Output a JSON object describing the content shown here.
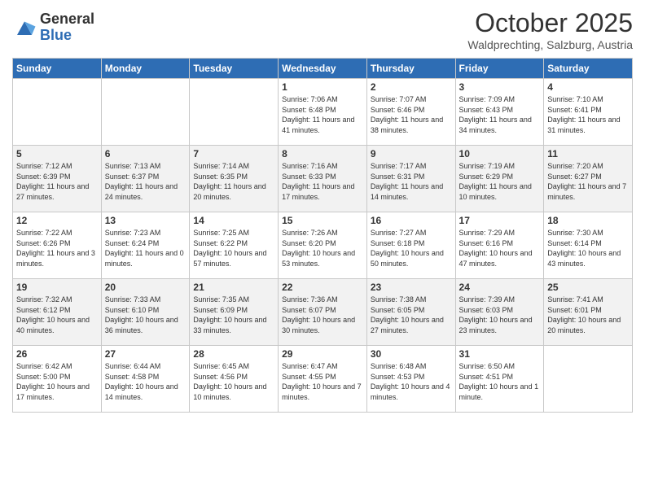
{
  "logo": {
    "general": "General",
    "blue": "Blue"
  },
  "header": {
    "month": "October 2025",
    "location": "Waldprechting, Salzburg, Austria"
  },
  "weekdays": [
    "Sunday",
    "Monday",
    "Tuesday",
    "Wednesday",
    "Thursday",
    "Friday",
    "Saturday"
  ],
  "weeks": [
    [
      {
        "day": "",
        "info": ""
      },
      {
        "day": "",
        "info": ""
      },
      {
        "day": "",
        "info": ""
      },
      {
        "day": "1",
        "info": "Sunrise: 7:06 AM\nSunset: 6:48 PM\nDaylight: 11 hours\nand 41 minutes."
      },
      {
        "day": "2",
        "info": "Sunrise: 7:07 AM\nSunset: 6:46 PM\nDaylight: 11 hours\nand 38 minutes."
      },
      {
        "day": "3",
        "info": "Sunrise: 7:09 AM\nSunset: 6:43 PM\nDaylight: 11 hours\nand 34 minutes."
      },
      {
        "day": "4",
        "info": "Sunrise: 7:10 AM\nSunset: 6:41 PM\nDaylight: 11 hours\nand 31 minutes."
      }
    ],
    [
      {
        "day": "5",
        "info": "Sunrise: 7:12 AM\nSunset: 6:39 PM\nDaylight: 11 hours\nand 27 minutes."
      },
      {
        "day": "6",
        "info": "Sunrise: 7:13 AM\nSunset: 6:37 PM\nDaylight: 11 hours\nand 24 minutes."
      },
      {
        "day": "7",
        "info": "Sunrise: 7:14 AM\nSunset: 6:35 PM\nDaylight: 11 hours\nand 20 minutes."
      },
      {
        "day": "8",
        "info": "Sunrise: 7:16 AM\nSunset: 6:33 PM\nDaylight: 11 hours\nand 17 minutes."
      },
      {
        "day": "9",
        "info": "Sunrise: 7:17 AM\nSunset: 6:31 PM\nDaylight: 11 hours\nand 14 minutes."
      },
      {
        "day": "10",
        "info": "Sunrise: 7:19 AM\nSunset: 6:29 PM\nDaylight: 11 hours\nand 10 minutes."
      },
      {
        "day": "11",
        "info": "Sunrise: 7:20 AM\nSunset: 6:27 PM\nDaylight: 11 hours\nand 7 minutes."
      }
    ],
    [
      {
        "day": "12",
        "info": "Sunrise: 7:22 AM\nSunset: 6:26 PM\nDaylight: 11 hours\nand 3 minutes."
      },
      {
        "day": "13",
        "info": "Sunrise: 7:23 AM\nSunset: 6:24 PM\nDaylight: 11 hours\nand 0 minutes."
      },
      {
        "day": "14",
        "info": "Sunrise: 7:25 AM\nSunset: 6:22 PM\nDaylight: 10 hours\nand 57 minutes."
      },
      {
        "day": "15",
        "info": "Sunrise: 7:26 AM\nSunset: 6:20 PM\nDaylight: 10 hours\nand 53 minutes."
      },
      {
        "day": "16",
        "info": "Sunrise: 7:27 AM\nSunset: 6:18 PM\nDaylight: 10 hours\nand 50 minutes."
      },
      {
        "day": "17",
        "info": "Sunrise: 7:29 AM\nSunset: 6:16 PM\nDaylight: 10 hours\nand 47 minutes."
      },
      {
        "day": "18",
        "info": "Sunrise: 7:30 AM\nSunset: 6:14 PM\nDaylight: 10 hours\nand 43 minutes."
      }
    ],
    [
      {
        "day": "19",
        "info": "Sunrise: 7:32 AM\nSunset: 6:12 PM\nDaylight: 10 hours\nand 40 minutes."
      },
      {
        "day": "20",
        "info": "Sunrise: 7:33 AM\nSunset: 6:10 PM\nDaylight: 10 hours\nand 36 minutes."
      },
      {
        "day": "21",
        "info": "Sunrise: 7:35 AM\nSunset: 6:09 PM\nDaylight: 10 hours\nand 33 minutes."
      },
      {
        "day": "22",
        "info": "Sunrise: 7:36 AM\nSunset: 6:07 PM\nDaylight: 10 hours\nand 30 minutes."
      },
      {
        "day": "23",
        "info": "Sunrise: 7:38 AM\nSunset: 6:05 PM\nDaylight: 10 hours\nand 27 minutes."
      },
      {
        "day": "24",
        "info": "Sunrise: 7:39 AM\nSunset: 6:03 PM\nDaylight: 10 hours\nand 23 minutes."
      },
      {
        "day": "25",
        "info": "Sunrise: 7:41 AM\nSunset: 6:01 PM\nDaylight: 10 hours\nand 20 minutes."
      }
    ],
    [
      {
        "day": "26",
        "info": "Sunrise: 6:42 AM\nSunset: 5:00 PM\nDaylight: 10 hours\nand 17 minutes."
      },
      {
        "day": "27",
        "info": "Sunrise: 6:44 AM\nSunset: 4:58 PM\nDaylight: 10 hours\nand 14 minutes."
      },
      {
        "day": "28",
        "info": "Sunrise: 6:45 AM\nSunset: 4:56 PM\nDaylight: 10 hours\nand 10 minutes."
      },
      {
        "day": "29",
        "info": "Sunrise: 6:47 AM\nSunset: 4:55 PM\nDaylight: 10 hours\nand 7 minutes."
      },
      {
        "day": "30",
        "info": "Sunrise: 6:48 AM\nSunset: 4:53 PM\nDaylight: 10 hours\nand 4 minutes."
      },
      {
        "day": "31",
        "info": "Sunrise: 6:50 AM\nSunset: 4:51 PM\nDaylight: 10 hours\nand 1 minute."
      },
      {
        "day": "",
        "info": ""
      }
    ]
  ]
}
